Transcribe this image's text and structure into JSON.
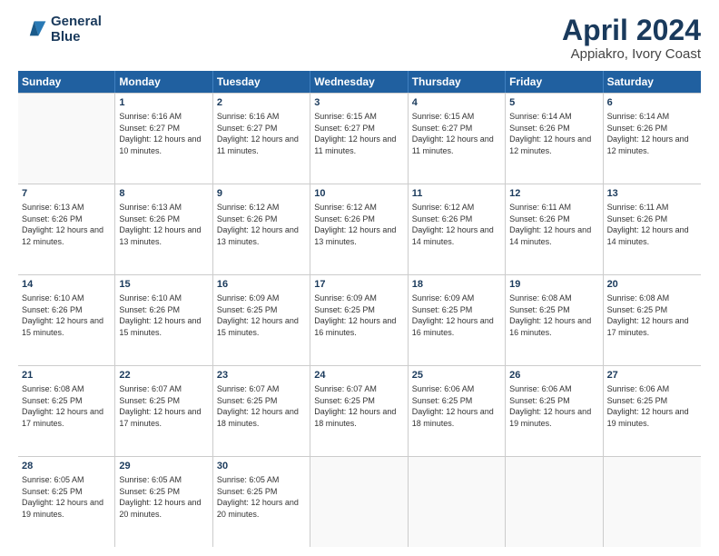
{
  "header": {
    "logo_line1": "General",
    "logo_line2": "Blue",
    "title": "April 2024",
    "subtitle": "Appiakro, Ivory Coast"
  },
  "days_of_week": [
    "Sunday",
    "Monday",
    "Tuesday",
    "Wednesday",
    "Thursday",
    "Friday",
    "Saturday"
  ],
  "weeks": [
    [
      {
        "day": "",
        "sunrise": "",
        "sunset": "",
        "daylight": ""
      },
      {
        "day": "1",
        "sunrise": "Sunrise: 6:16 AM",
        "sunset": "Sunset: 6:27 PM",
        "daylight": "Daylight: 12 hours and 10 minutes."
      },
      {
        "day": "2",
        "sunrise": "Sunrise: 6:16 AM",
        "sunset": "Sunset: 6:27 PM",
        "daylight": "Daylight: 12 hours and 11 minutes."
      },
      {
        "day": "3",
        "sunrise": "Sunrise: 6:15 AM",
        "sunset": "Sunset: 6:27 PM",
        "daylight": "Daylight: 12 hours and 11 minutes."
      },
      {
        "day": "4",
        "sunrise": "Sunrise: 6:15 AM",
        "sunset": "Sunset: 6:27 PM",
        "daylight": "Daylight: 12 hours and 11 minutes."
      },
      {
        "day": "5",
        "sunrise": "Sunrise: 6:14 AM",
        "sunset": "Sunset: 6:26 PM",
        "daylight": "Daylight: 12 hours and 12 minutes."
      },
      {
        "day": "6",
        "sunrise": "Sunrise: 6:14 AM",
        "sunset": "Sunset: 6:26 PM",
        "daylight": "Daylight: 12 hours and 12 minutes."
      }
    ],
    [
      {
        "day": "7",
        "sunrise": "Sunrise: 6:13 AM",
        "sunset": "Sunset: 6:26 PM",
        "daylight": "Daylight: 12 hours and 12 minutes."
      },
      {
        "day": "8",
        "sunrise": "Sunrise: 6:13 AM",
        "sunset": "Sunset: 6:26 PM",
        "daylight": "Daylight: 12 hours and 13 minutes."
      },
      {
        "day": "9",
        "sunrise": "Sunrise: 6:12 AM",
        "sunset": "Sunset: 6:26 PM",
        "daylight": "Daylight: 12 hours and 13 minutes."
      },
      {
        "day": "10",
        "sunrise": "Sunrise: 6:12 AM",
        "sunset": "Sunset: 6:26 PM",
        "daylight": "Daylight: 12 hours and 13 minutes."
      },
      {
        "day": "11",
        "sunrise": "Sunrise: 6:12 AM",
        "sunset": "Sunset: 6:26 PM",
        "daylight": "Daylight: 12 hours and 14 minutes."
      },
      {
        "day": "12",
        "sunrise": "Sunrise: 6:11 AM",
        "sunset": "Sunset: 6:26 PM",
        "daylight": "Daylight: 12 hours and 14 minutes."
      },
      {
        "day": "13",
        "sunrise": "Sunrise: 6:11 AM",
        "sunset": "Sunset: 6:26 PM",
        "daylight": "Daylight: 12 hours and 14 minutes."
      }
    ],
    [
      {
        "day": "14",
        "sunrise": "Sunrise: 6:10 AM",
        "sunset": "Sunset: 6:26 PM",
        "daylight": "Daylight: 12 hours and 15 minutes."
      },
      {
        "day": "15",
        "sunrise": "Sunrise: 6:10 AM",
        "sunset": "Sunset: 6:26 PM",
        "daylight": "Daylight: 12 hours and 15 minutes."
      },
      {
        "day": "16",
        "sunrise": "Sunrise: 6:09 AM",
        "sunset": "Sunset: 6:25 PM",
        "daylight": "Daylight: 12 hours and 15 minutes."
      },
      {
        "day": "17",
        "sunrise": "Sunrise: 6:09 AM",
        "sunset": "Sunset: 6:25 PM",
        "daylight": "Daylight: 12 hours and 16 minutes."
      },
      {
        "day": "18",
        "sunrise": "Sunrise: 6:09 AM",
        "sunset": "Sunset: 6:25 PM",
        "daylight": "Daylight: 12 hours and 16 minutes."
      },
      {
        "day": "19",
        "sunrise": "Sunrise: 6:08 AM",
        "sunset": "Sunset: 6:25 PM",
        "daylight": "Daylight: 12 hours and 16 minutes."
      },
      {
        "day": "20",
        "sunrise": "Sunrise: 6:08 AM",
        "sunset": "Sunset: 6:25 PM",
        "daylight": "Daylight: 12 hours and 17 minutes."
      }
    ],
    [
      {
        "day": "21",
        "sunrise": "Sunrise: 6:08 AM",
        "sunset": "Sunset: 6:25 PM",
        "daylight": "Daylight: 12 hours and 17 minutes."
      },
      {
        "day": "22",
        "sunrise": "Sunrise: 6:07 AM",
        "sunset": "Sunset: 6:25 PM",
        "daylight": "Daylight: 12 hours and 17 minutes."
      },
      {
        "day": "23",
        "sunrise": "Sunrise: 6:07 AM",
        "sunset": "Sunset: 6:25 PM",
        "daylight": "Daylight: 12 hours and 18 minutes."
      },
      {
        "day": "24",
        "sunrise": "Sunrise: 6:07 AM",
        "sunset": "Sunset: 6:25 PM",
        "daylight": "Daylight: 12 hours and 18 minutes."
      },
      {
        "day": "25",
        "sunrise": "Sunrise: 6:06 AM",
        "sunset": "Sunset: 6:25 PM",
        "daylight": "Daylight: 12 hours and 18 minutes."
      },
      {
        "day": "26",
        "sunrise": "Sunrise: 6:06 AM",
        "sunset": "Sunset: 6:25 PM",
        "daylight": "Daylight: 12 hours and 19 minutes."
      },
      {
        "day": "27",
        "sunrise": "Sunrise: 6:06 AM",
        "sunset": "Sunset: 6:25 PM",
        "daylight": "Daylight: 12 hours and 19 minutes."
      }
    ],
    [
      {
        "day": "28",
        "sunrise": "Sunrise: 6:05 AM",
        "sunset": "Sunset: 6:25 PM",
        "daylight": "Daylight: 12 hours and 19 minutes."
      },
      {
        "day": "29",
        "sunrise": "Sunrise: 6:05 AM",
        "sunset": "Sunset: 6:25 PM",
        "daylight": "Daylight: 12 hours and 20 minutes."
      },
      {
        "day": "30",
        "sunrise": "Sunrise: 6:05 AM",
        "sunset": "Sunset: 6:25 PM",
        "daylight": "Daylight: 12 hours and 20 minutes."
      },
      {
        "day": "",
        "sunrise": "",
        "sunset": "",
        "daylight": ""
      },
      {
        "day": "",
        "sunrise": "",
        "sunset": "",
        "daylight": ""
      },
      {
        "day": "",
        "sunrise": "",
        "sunset": "",
        "daylight": ""
      },
      {
        "day": "",
        "sunrise": "",
        "sunset": "",
        "daylight": ""
      }
    ]
  ]
}
